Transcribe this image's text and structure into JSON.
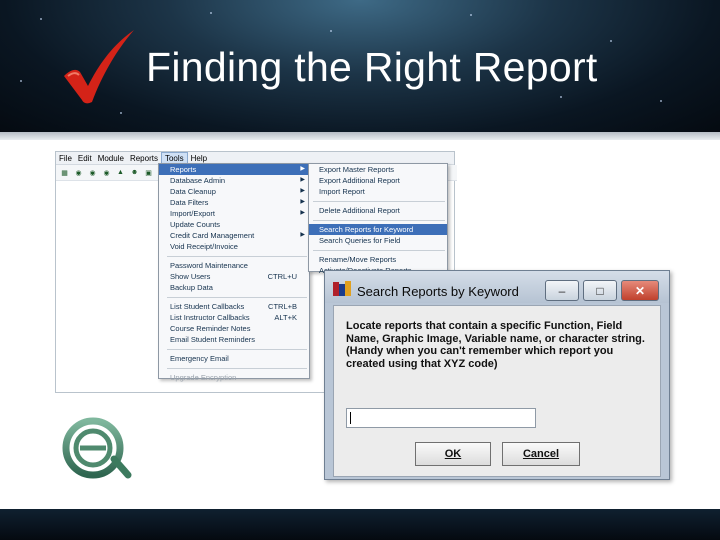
{
  "slide": {
    "title": "Finding the Right Report"
  },
  "menubar": {
    "items": [
      "File",
      "Edit",
      "Module",
      "Reports",
      "Tools",
      "Help"
    ],
    "active": "Tools"
  },
  "toolbar": {
    "icons": [
      "report-icon",
      "binoculars-icon",
      "binoculars-icon",
      "binoculars-icon",
      "export-icon",
      "users-icon",
      "gift-icon",
      "binoculars-icon",
      "report-icon"
    ]
  },
  "tools_menu": {
    "items": [
      {
        "label": "Reports",
        "submenu": true,
        "highlighted": true
      },
      {
        "label": "Database Admin",
        "submenu": true
      },
      {
        "label": "Data Cleanup",
        "submenu": true
      },
      {
        "label": "Data Filters",
        "submenu": true
      },
      {
        "label": "Import/Export",
        "submenu": true
      },
      {
        "label": "Update Counts"
      },
      {
        "label": "Credit Card Management",
        "submenu": true
      },
      {
        "label": "Void Receipt/Invoice"
      },
      {
        "separator": true
      },
      {
        "label": "Password Maintenance"
      },
      {
        "label": "Show Users",
        "shortcut": "CTRL+U"
      },
      {
        "label": "Backup Data"
      },
      {
        "separator": true
      },
      {
        "label": "List Student Callbacks",
        "shortcut": "CTRL+B"
      },
      {
        "label": "List Instructor Callbacks",
        "shortcut": "ALT+K"
      },
      {
        "label": "Course Reminder Notes"
      },
      {
        "label": "Email Student Reminders"
      },
      {
        "separator": true
      },
      {
        "label": "Emergency Email"
      },
      {
        "separator": true
      },
      {
        "label": "Upgrade Encryption",
        "disabled": true
      }
    ]
  },
  "reports_submenu": {
    "items": [
      {
        "label": "Export Master Reports"
      },
      {
        "label": "Export Additional Report"
      },
      {
        "label": "Import Report"
      },
      {
        "separator": true
      },
      {
        "label": "Delete Additional Report"
      },
      {
        "separator": true
      },
      {
        "label": "Search Reports for Keyword",
        "highlighted": true
      },
      {
        "label": "Search Queries for Field"
      },
      {
        "separator": true
      },
      {
        "label": "Rename/Move Reports"
      },
      {
        "label": "Activate/Deactivate Reports"
      }
    ]
  },
  "dialog": {
    "title": "Search Reports by Keyword",
    "description": "Locate reports that contain a specific Function, Field Name, Graphic Image, Variable name, or character string.  (Handy when you can't remember which report you created using that XYZ code)",
    "keyword_value": "",
    "ok_label": "OK",
    "cancel_label": "Cancel",
    "minimize_symbol": "‒",
    "maximize_symbol": "□",
    "close_symbol": "✕"
  },
  "colors": {
    "accent": "#3d6fb8",
    "check_red": "#d42318",
    "logo_green": "#4f8a6e"
  }
}
